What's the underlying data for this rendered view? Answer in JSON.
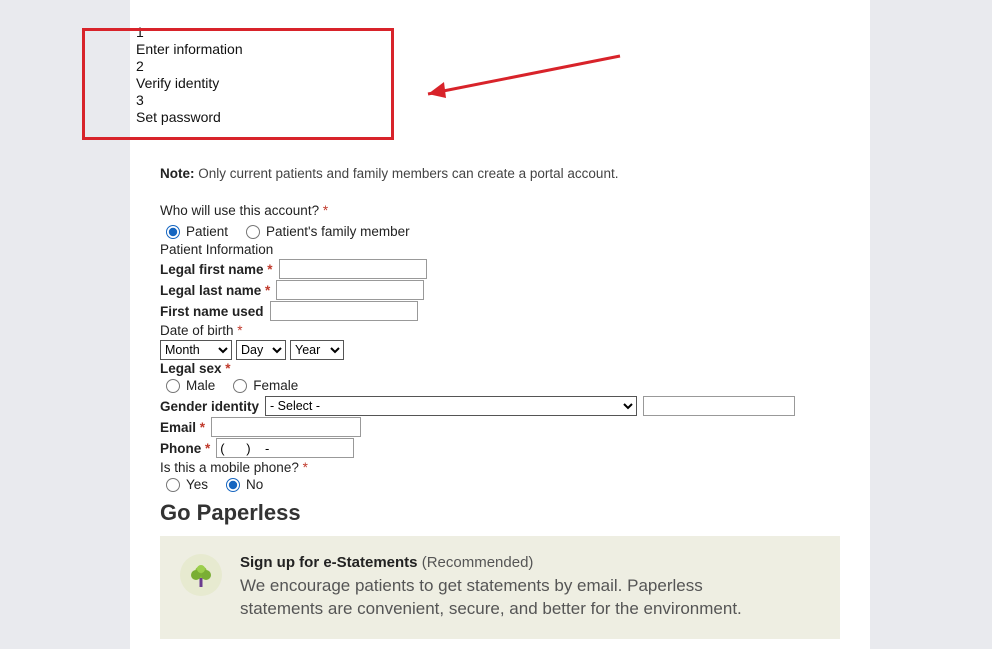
{
  "steps": {
    "n1": "1",
    "t1": "Enter information",
    "n2": "2",
    "t2": "Verify identity",
    "n3": "3",
    "t3": "Set password"
  },
  "note": {
    "prefix": "Note:",
    "text": " Only current patients and family members can create a portal account."
  },
  "who": {
    "question": "Who will use this account?",
    "opt_patient": "Patient",
    "opt_family": "Patient's family member"
  },
  "section_patient_info": "Patient Information",
  "labels": {
    "first": "Legal first name",
    "last": "Legal last name",
    "used": "First name used",
    "dob": "Date of birth",
    "sex": "Legal sex",
    "male": "Male",
    "female": "Female",
    "gender_identity": "Gender identity",
    "email": "Email",
    "phone": "Phone",
    "is_mobile": "Is this a mobile phone?",
    "yes": "Yes",
    "no": "No"
  },
  "selects": {
    "month": "Month",
    "day": "Day",
    "year": "Year",
    "gender_placeholder": "- Select -"
  },
  "phone_value": "(      )    -",
  "paperless": {
    "heading": "Go Paperless",
    "title": "Sign up for e-Statements",
    "reco": " (Recommended)",
    "body": "We encourage patients to get statements by email. Paperless statements are convenient, secure, and better for the environment."
  },
  "asterisk": " *"
}
